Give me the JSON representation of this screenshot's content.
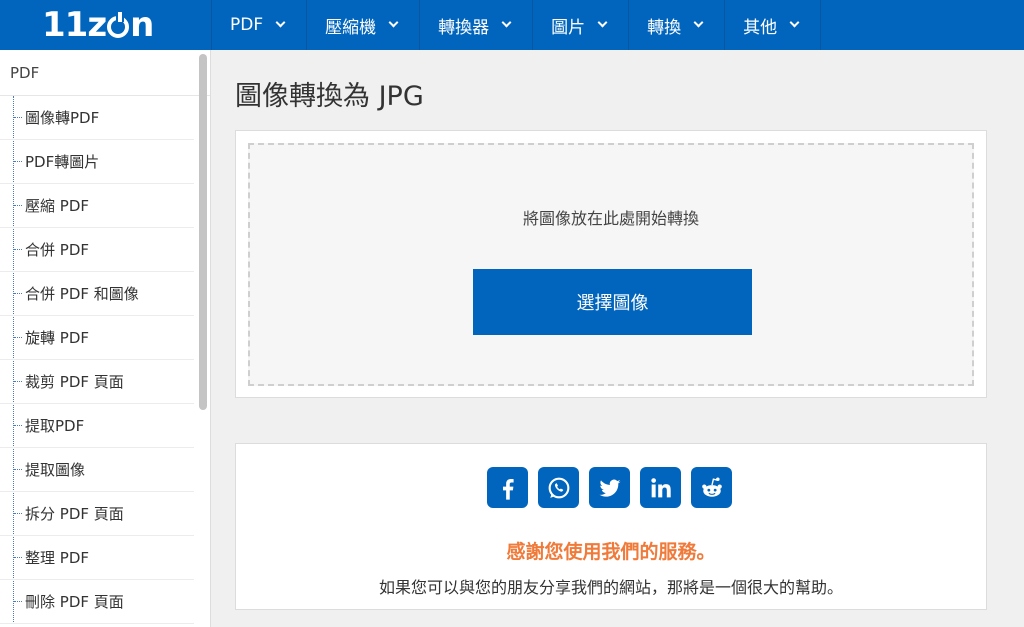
{
  "header": {
    "logo_text_a": "11z",
    "logo_text_b": "n",
    "nav": [
      {
        "label": "PDF"
      },
      {
        "label": "壓縮機"
      },
      {
        "label": "轉換器"
      },
      {
        "label": "圖片"
      },
      {
        "label": "轉換"
      },
      {
        "label": "其他"
      }
    ]
  },
  "sidebar": {
    "section_title": "PDF",
    "items": [
      {
        "label": "圖像轉PDF"
      },
      {
        "label": "PDF轉圖片"
      },
      {
        "label": "壓縮 PDF"
      },
      {
        "label": "合併 PDF"
      },
      {
        "label": "合併 PDF 和圖像"
      },
      {
        "label": "旋轉 PDF"
      },
      {
        "label": "裁剪 PDF 頁面"
      },
      {
        "label": "提取PDF"
      },
      {
        "label": "提取圖像"
      },
      {
        "label": "拆分 PDF 頁面"
      },
      {
        "label": "整理 PDF"
      },
      {
        "label": "刪除 PDF 頁面"
      }
    ]
  },
  "main": {
    "title": "圖像轉換為 JPG",
    "drop_text": "將圖像放在此處開始轉換",
    "choose_button": "選擇圖像",
    "share": {
      "icons": [
        "facebook-icon",
        "whatsapp-icon",
        "twitter-icon",
        "linkedin-icon",
        "reddit-icon"
      ],
      "thanks": "感謝您使用我們的服務。",
      "description": "如果您可以與您的朋友分享我們的網站，那將是一個很大的幫助。"
    }
  },
  "colors": {
    "brand": "#0165bd",
    "accent": "#f07a3a"
  }
}
